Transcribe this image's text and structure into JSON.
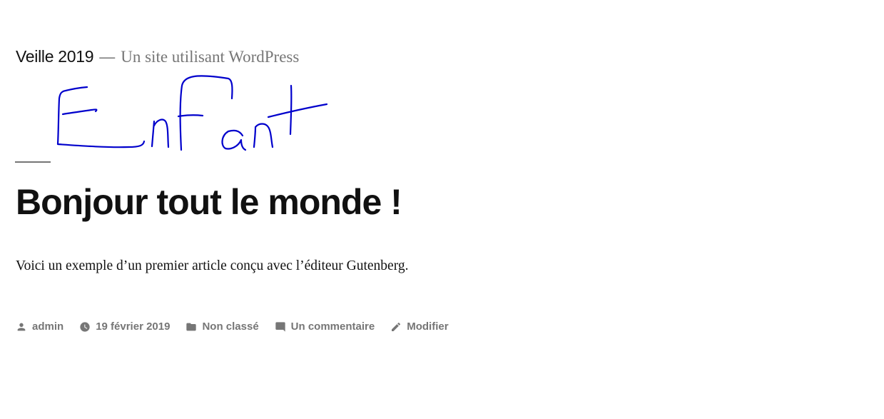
{
  "header": {
    "site_title": "Veille 2019",
    "separator": "—",
    "tagline": "Un site utilisant WordPress"
  },
  "handwriting": {
    "text": "Enfant",
    "color": "#0000cc"
  },
  "post": {
    "title": "Bonjour tout le monde !",
    "content": "Voici un exemple d’un premier article conçu avec l’éditeur Gutenberg."
  },
  "footer": {
    "author": {
      "icon": "person-icon",
      "label": "admin"
    },
    "date": {
      "icon": "clock-icon",
      "label": "19 février 2019"
    },
    "category": {
      "icon": "folder-icon",
      "label": "Non classé"
    },
    "comments": {
      "icon": "comment-icon",
      "label": "Un commentaire"
    },
    "edit": {
      "icon": "pencil-icon",
      "label": "Modifier"
    }
  },
  "colors": {
    "text": "#111111",
    "muted": "#767676",
    "background": "#ffffff"
  }
}
